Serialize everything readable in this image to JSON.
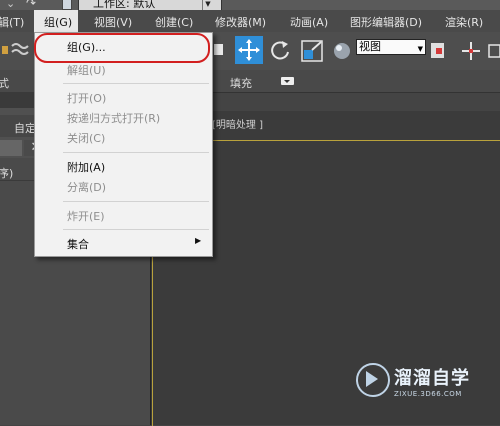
{
  "top_strip": {
    "workspace_label": "工作区: 默认"
  },
  "menubar": {
    "items": [
      {
        "id": "edit",
        "label": "辑(T)"
      },
      {
        "id": "group",
        "label": "组(G)"
      },
      {
        "id": "view",
        "label": "视图(V)"
      },
      {
        "id": "create",
        "label": "创建(C)"
      },
      {
        "id": "modifiers",
        "label": "修改器(M)"
      },
      {
        "id": "animation",
        "label": "动画(A)"
      },
      {
        "id": "graph_editors",
        "label": "图形编辑器(D)"
      },
      {
        "id": "rendering",
        "label": "渲染(R)"
      }
    ]
  },
  "toolbar": {
    "reference_coord": "视图"
  },
  "ribbon": {
    "left_label": "式",
    "fill_label": "填充"
  },
  "left_panel": {
    "tab_label": "自定",
    "list_label": "序)"
  },
  "viewport": {
    "label": "[明暗处理 ]"
  },
  "group_menu": {
    "items": [
      {
        "id": "group",
        "label": "组(G)...",
        "enabled": true,
        "highlighted": true
      },
      {
        "id": "ungroup",
        "label": "解组(U)",
        "enabled": false
      },
      {
        "id": "open",
        "label": "打开(O)",
        "enabled": false
      },
      {
        "id": "open_recursive",
        "label": "按递归方式打开(R)",
        "enabled": false
      },
      {
        "id": "close",
        "label": "关闭(C)",
        "enabled": false
      },
      {
        "id": "attach",
        "label": "附加(A)",
        "enabled": true
      },
      {
        "id": "detach",
        "label": "分离(D)",
        "enabled": false
      },
      {
        "id": "explode",
        "label": "炸开(E)",
        "enabled": false
      },
      {
        "id": "assembly",
        "label": "集合",
        "enabled": true,
        "submenu": true
      }
    ]
  },
  "watermark": {
    "title": "溜溜自学",
    "url": "ZIXUE.3D66.COM"
  },
  "colors": {
    "accent_highlight": "#d21f1f",
    "viewport_border": "#b9a23c",
    "menu_bg": "#f2f2f2",
    "app_bg": "#4a4a4a"
  }
}
